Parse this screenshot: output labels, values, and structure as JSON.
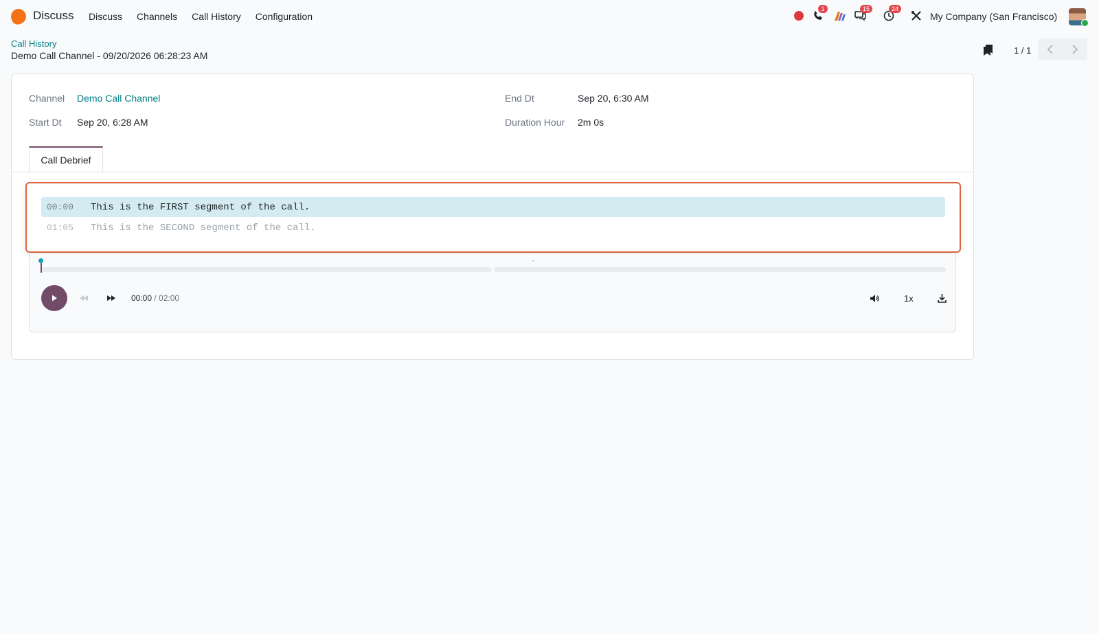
{
  "navbar": {
    "app_name": "Discuss",
    "menu": [
      "Discuss",
      "Channels",
      "Call History",
      "Configuration"
    ],
    "badges": {
      "calls": "1",
      "messages": "15",
      "activities": "24"
    },
    "company": "My Company (San Francisco)"
  },
  "control_panel": {
    "breadcrumb": "Call History",
    "record_title": "Demo Call Channel - 09/20/2026 06:28:23 AM",
    "pager": "1 / 1"
  },
  "form": {
    "channel_label": "Channel",
    "channel_value": "Demo Call Channel",
    "start_label": "Start Dt",
    "start_value": "Sep 20, 6:28 AM",
    "end_label": "End Dt",
    "end_value": "Sep 20, 6:30 AM",
    "duration_label": "Duration Hour",
    "duration_value": "2m 0s",
    "tab_label": "Call Debrief"
  },
  "transcript": {
    "segments": [
      {
        "time": "00:00",
        "text": "This is the FIRST segment of the call."
      },
      {
        "time": "01:05",
        "text": "This is the SECOND segment of the call."
      }
    ]
  },
  "player": {
    "current_time": "00:00",
    "separator": " / ",
    "total_time": "02:00",
    "speed": "1x",
    "progress": 0
  },
  "colors": {
    "brand": "#714b67",
    "link": "#017e84",
    "highlight_border": "#d9643f",
    "active_segment": "#d4ecf1"
  }
}
